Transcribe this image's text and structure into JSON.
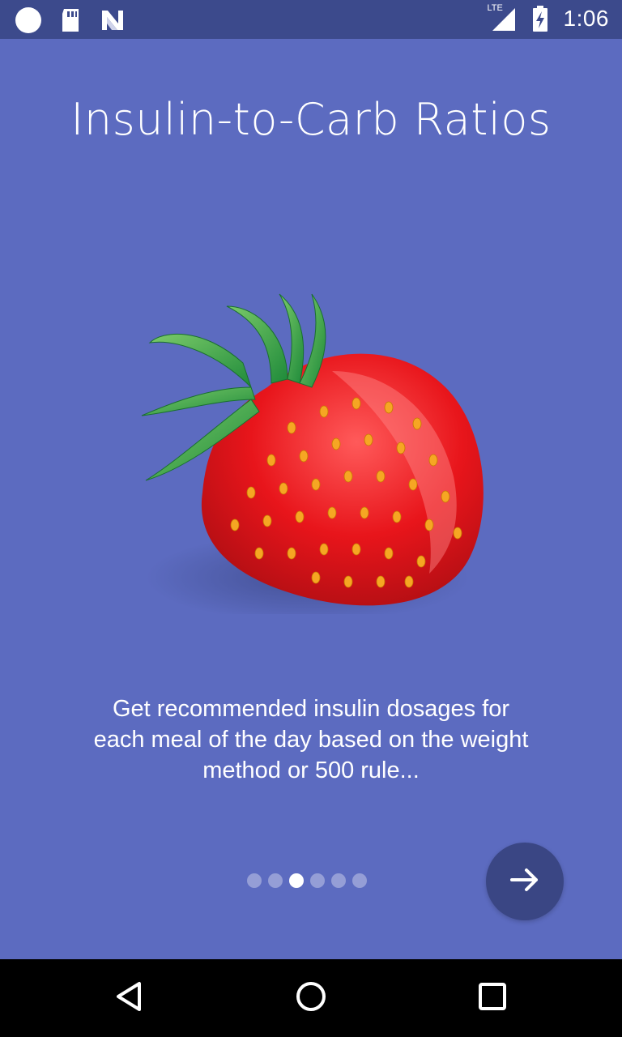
{
  "status_bar": {
    "time": "1:06",
    "network": "LTE",
    "icons": [
      "circle-notification-icon",
      "sd-card-icon",
      "n-logo-icon",
      "signal-icon",
      "battery-charging-icon"
    ]
  },
  "onboarding": {
    "title": "Insulin-to-Carb Ratios",
    "image": "strawberry-illustration",
    "description": "Get recommended insulin dosages for each meal of the day based on the weight method or 500 rule...",
    "page_indicator": {
      "total": 6,
      "current": 3
    },
    "next_icon": "arrow-right-icon"
  },
  "nav_bar": {
    "icons": [
      "back-icon",
      "home-icon",
      "recents-icon"
    ]
  },
  "colors": {
    "background": "#5c6bc0",
    "status_bar": "#3c4a8c",
    "next_button": "#3a4684"
  }
}
